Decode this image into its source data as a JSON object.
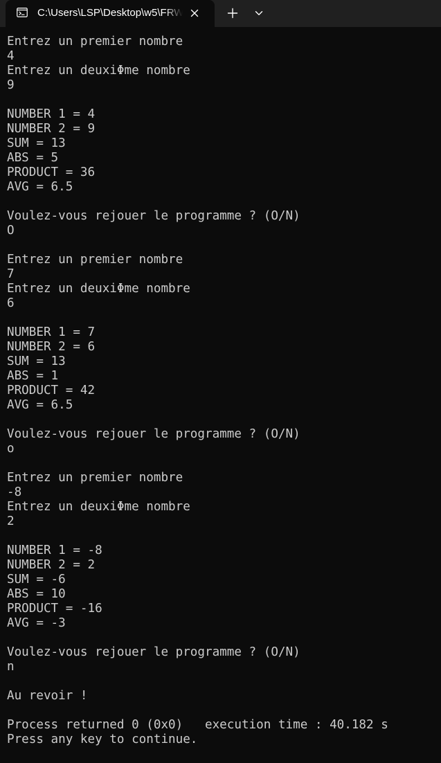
{
  "tab": {
    "title": "C:\\Users\\LSP\\Desktop\\w5\\FRW"
  },
  "icons": {
    "tab_icon": "terminal-icon",
    "close": "close-icon",
    "new_tab": "plus-icon",
    "dropdown": "chevron-down-icon"
  },
  "colors": {
    "background": "#0c0c0c",
    "tabbar": "#202020",
    "text": "#cccccc"
  },
  "console": {
    "lines": [
      "Entrez un premier nombre",
      "4",
      "Entrez un deuxiΦme nombre",
      "9",
      "",
      "NUMBER 1 = 4",
      "NUMBER 2 = 9",
      "SUM = 13",
      "ABS = 5",
      "PRODUCT = 36",
      "AVG = 6.5",
      "",
      "Voulez-vous rejouer le programme ? (O/N)",
      "O",
      "",
      "Entrez un premier nombre",
      "7",
      "Entrez un deuxiΦme nombre",
      "6",
      "",
      "NUMBER 1 = 7",
      "NUMBER 2 = 6",
      "SUM = 13",
      "ABS = 1",
      "PRODUCT = 42",
      "AVG = 6.5",
      "",
      "Voulez-vous rejouer le programme ? (O/N)",
      "o",
      "",
      "Entrez un premier nombre",
      "-8",
      "Entrez un deuxiΦme nombre",
      "2",
      "",
      "NUMBER 1 = -8",
      "NUMBER 2 = 2",
      "SUM = -6",
      "ABS = 10",
      "PRODUCT = -16",
      "AVG = -3",
      "",
      "Voulez-vous rejouer le programme ? (O/N)",
      "n",
      "",
      "Au revoir !",
      "",
      "Process returned 0 (0x0)   execution time : 40.182 s",
      "Press any key to continue."
    ]
  }
}
